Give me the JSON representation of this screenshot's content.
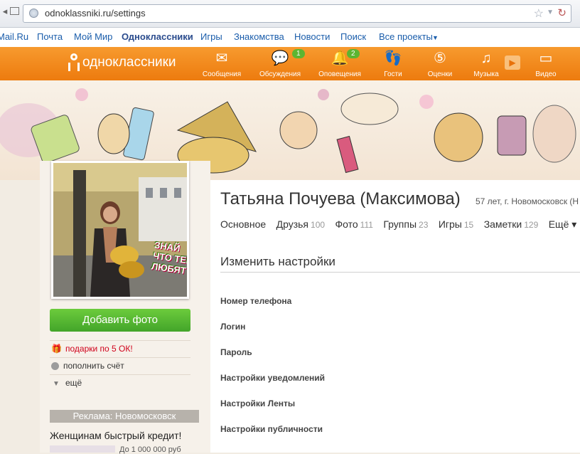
{
  "browser": {
    "url": "odnoklassniki.ru/settings"
  },
  "portal": {
    "links": [
      "Mail.Ru",
      "Почта",
      "Мой Мир",
      "Одноклассники",
      "Игры",
      "Знакомства",
      "Новости",
      "Поиск",
      "Все проекты"
    ]
  },
  "topbar": {
    "logo": "одноклассники",
    "items": [
      {
        "label": "Сообщения",
        "icon": "envelope-icon"
      },
      {
        "label": "Обсуждения",
        "icon": "chat-bubbles-icon",
        "badge": "1"
      },
      {
        "label": "Оповещения",
        "icon": "bell-icon",
        "badge": "2"
      },
      {
        "label": "Гости",
        "icon": "footprints-icon"
      },
      {
        "label": "Оценки",
        "icon": "rating-icon"
      },
      {
        "label": "Музыка",
        "icon": "music-note-icon"
      },
      {
        "label": "Видео",
        "icon": "video-icon"
      }
    ],
    "accent": "#f08a1c"
  },
  "profile": {
    "name": "Татьяна Почуева (Максимова)",
    "meta": "57 лет, г. Новомосковск (Н",
    "photo_overlay": "ЗНАЙ ЧТО ТЕБЯ ЛЮБЯТ",
    "tabs": [
      {
        "label": "Основное",
        "count": ""
      },
      {
        "label": "Друзья",
        "count": "100"
      },
      {
        "label": "Фото",
        "count": "111"
      },
      {
        "label": "Группы",
        "count": "23"
      },
      {
        "label": "Игры",
        "count": "15"
      },
      {
        "label": "Заметки",
        "count": "129"
      },
      {
        "label": "Ещё ▾",
        "count": ""
      }
    ]
  },
  "sidebar": {
    "add_photo": "Добавить фото",
    "links": [
      {
        "label": "подарки по 5 ОК!",
        "icon": "gift-icon",
        "color": "#d0021b"
      },
      {
        "label": "пополнить счёт",
        "icon": "coin-icon",
        "color": "#333333"
      },
      {
        "label": "ещё",
        "icon": "triangle-down-icon",
        "color": "#333333"
      }
    ],
    "ad_header": "Реклама: Новомосковск",
    "ad_title": "Женщинам быстрый кредит!",
    "ad_text": "До 1 000 000 руб"
  },
  "settings": {
    "title": "Изменить настройки",
    "items": [
      "Номер телефона",
      "Логин",
      "Пароль",
      "Настройки уведомлений",
      "Настройки Ленты",
      "Настройки публичности"
    ]
  }
}
